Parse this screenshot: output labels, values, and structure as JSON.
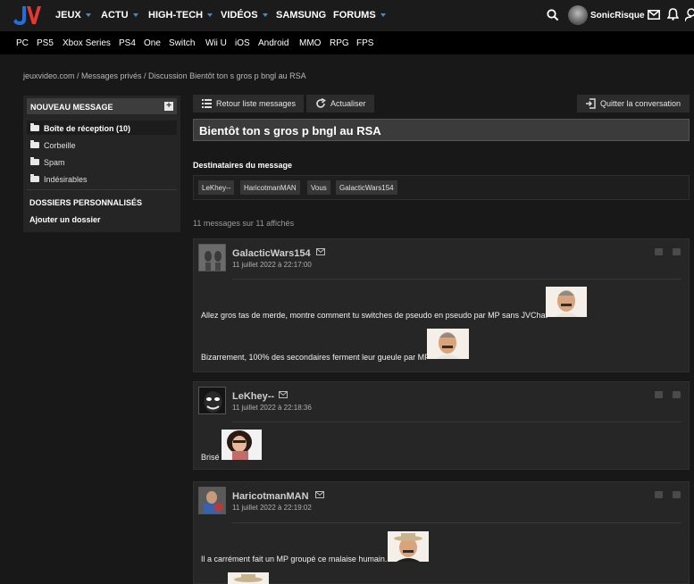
{
  "nav": {
    "items": [
      {
        "label": "JEUX",
        "dropdown": true
      },
      {
        "label": "ACTU",
        "dropdown": true
      },
      {
        "label": "HIGH-TECH",
        "dropdown": true
      },
      {
        "label": "VIDÉOS",
        "dropdown": true
      },
      {
        "label": "SAMSUNG",
        "dropdown": false
      },
      {
        "label": "FORUMS",
        "dropdown": true
      }
    ],
    "username": "SonicRisque",
    "accent": "#3d8dd6"
  },
  "platforms": [
    "PC",
    "PS5",
    "Xbox Series",
    "PS4",
    "One",
    "Switch",
    "Wii U",
    "iOS",
    "Android",
    "MMO",
    "RPG",
    "FPS"
  ],
  "breadcrumb": "jeuxvideo.com / Messages privés / Discussion Bientôt ton s gros p bngl au RSA",
  "sidebar": {
    "new_message": "NOUVEAU MESSAGE",
    "folders": [
      {
        "label": "Boîte de réception (10)",
        "active": true
      },
      {
        "label": "Corbeille",
        "active": false
      },
      {
        "label": "Spam",
        "active": false
      },
      {
        "label": "Indésirables",
        "active": false
      }
    ],
    "custom_title": "DOSSIERS PERSONNALISÉS",
    "add_folder": "Ajouter un dossier"
  },
  "toolbar": {
    "back": "Retour liste messages",
    "refresh": "Actualiser",
    "quit": "Quitter la conversation"
  },
  "conversation": {
    "title": "Bientôt ton s gros p bngl au RSA",
    "recipients_title": "Destinataires du message",
    "recipients": [
      "LeKhey--",
      "HaricotmanMAN",
      "Vous",
      "GalacticWars154"
    ],
    "count_text": "11 messages sur 11 affichés"
  },
  "messages": [
    {
      "author": "GalacticWars154",
      "date": "11 juillet 2022 à 22:17:00",
      "lines": [
        "Allez gros tas de merde, montre comment tu switches de pseudo en pseudo par MP sans JVChat",
        "Bizarrement, 100% des secondaires ferment leur gueule par MP"
      ]
    },
    {
      "author": "LeKhey--",
      "date": "11 juillet 2022 à 22:18:36",
      "lines": [
        "Brisé"
      ]
    },
    {
      "author": "HaricotmanMAN",
      "date": "11 juillet 2022 à 22:19:02",
      "lines": [
        "Il a carrément fait un MP groupé ce malaise humain."
      ]
    }
  ]
}
